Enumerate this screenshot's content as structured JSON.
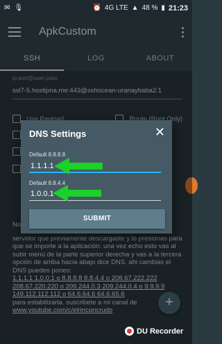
{
  "status_bar": {
    "network": "4G LTE",
    "battery": "48 %",
    "time": "21:23"
  },
  "app_bar": {
    "title": "ApkCustom"
  },
  "tabs": [
    {
      "label": "SSH",
      "active": true
    },
    {
      "label": "LOG",
      "active": false
    },
    {
      "label": "ABOUT",
      "active": false
    }
  ],
  "ssh": {
    "field_label": "ip:port@user:pass",
    "field_value": "ssl7-5.hostipna.me:443@sshocean-uranaybaba2:1",
    "checkbox_1_label": "Use Payload",
    "checkbox_1b_label": "Route (Root Only)"
  },
  "background_text": {
    "line_1": "No",
    "paragraph": "servidor que previamente descargaste y lo presionas para que se importe a la aplicación. una vez echo esto vas al subir menú de la parte superior derecha y vas a la tercera opción de arriba hacia abajo dice DNS. ahi cambias el DNS puedes pones:",
    "dns_list_1": "1.1.1.1 1.0.0.1 o 8.8.8.8 8.8.4.4 o 208.67.222.222 208.67.220.220 o 209.244.0.3 209.244.0.4 o 9.9.9.9 149.112.112.112 o 64.6.64.6 64.6.65.6",
    "paragraph_end": "para estabilizarla. suscribete a mi canal de",
    "link": "www.youtube.com/c/elrinconcrudo"
  },
  "dialog": {
    "title": "DNS Settings",
    "close_icon": "close-icon",
    "dns1_label": "Default 8.8.8.8",
    "dns1_value": "1.1.1.1",
    "dns2_label": "Default 8.8.4.4",
    "dns2_value": "1.0.0.1",
    "submit_label": "SUBMIT"
  },
  "recorder": {
    "label": "DU Recorder"
  },
  "colors": {
    "app_bar": "#37474f",
    "dialog": "#455a64",
    "submit": "#607d8b",
    "annotation_arrow": "#1bd12a",
    "focus_underline": "#29b6f6"
  }
}
